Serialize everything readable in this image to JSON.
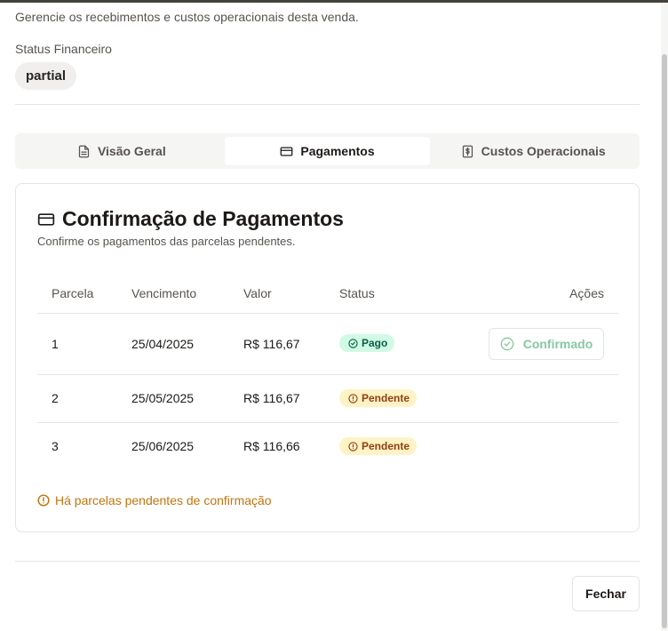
{
  "header": {
    "subtitle": "Gerencie os recebimentos e custos operacionais desta venda.",
    "status_label": "Status Financeiro",
    "status_value": "partial"
  },
  "tabs": [
    {
      "label": "Visão Geral",
      "icon": "file-text-icon",
      "active": false
    },
    {
      "label": "Pagamentos",
      "icon": "credit-card-icon",
      "active": true
    },
    {
      "label": "Custos Operacionais",
      "icon": "receipt-dollar-icon",
      "active": false
    }
  ],
  "card": {
    "title": "Confirmação de Pagamentos",
    "description": "Confirme os pagamentos das parcelas pendentes."
  },
  "table": {
    "columns": [
      "Parcela",
      "Vencimento",
      "Valor",
      "Status",
      "Ações"
    ],
    "rows": [
      {
        "parcela": "1",
        "vencimento": "25/04/2025",
        "valor": "R$ 116,67",
        "status": "Pago",
        "action": "Confirmado"
      },
      {
        "parcela": "2",
        "vencimento": "25/05/2025",
        "valor": "R$ 116,67",
        "status": "Pendente",
        "action": ""
      },
      {
        "parcela": "3",
        "vencimento": "25/06/2025",
        "valor": "R$ 116,66",
        "status": "Pendente",
        "action": ""
      }
    ]
  },
  "warning": "Há parcelas pendentes de confirmação",
  "footer": {
    "close_label": "Fechar"
  },
  "colors": {
    "paid_bg": "#d1fae5",
    "paid_text": "#065f46",
    "pending_bg": "#fef3c7",
    "pending_text": "#92400e",
    "warning": "#c2740c"
  }
}
